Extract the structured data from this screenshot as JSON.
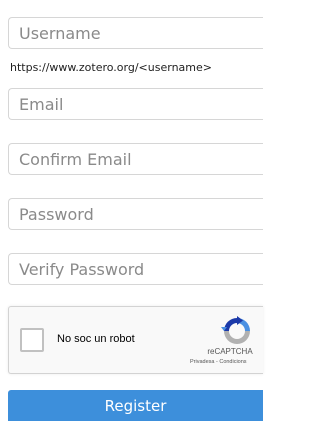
{
  "form": {
    "username": {
      "value": "",
      "placeholder": "Username"
    },
    "username_hint": "https://www.zotero.org/<username>",
    "email": {
      "value": "",
      "placeholder": "Email"
    },
    "confirm_email": {
      "value": "",
      "placeholder": "Confirm Email"
    },
    "password": {
      "value": "",
      "placeholder": "Password"
    },
    "verify_password": {
      "value": "",
      "placeholder": "Verify Password"
    },
    "register_label": "Register"
  },
  "captcha": {
    "label": "No soc un robot",
    "brand": "reCAPTCHA",
    "terms": "Privadesa - Condicions",
    "checked": false
  },
  "colors": {
    "accent": "#3d8fdb",
    "captcha_logo_blue": "#1c3aa9",
    "captcha_logo_light": "#4a90e2",
    "captcha_logo_gray": "#b1b1b1"
  }
}
